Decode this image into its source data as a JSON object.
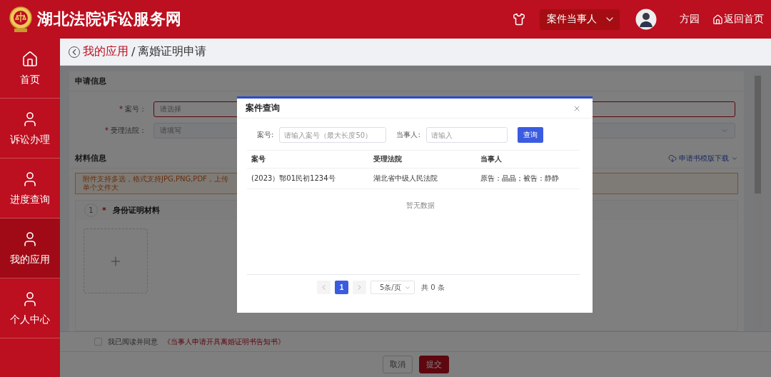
{
  "header": {
    "title": "湖北法院诉讼服务网",
    "role_select": {
      "value": "案件当事人"
    },
    "user_name": "方园",
    "home_link": "返回首页"
  },
  "sidebar": {
    "items": [
      {
        "label": "首页",
        "kind": "home",
        "selected": false
      },
      {
        "label": "诉讼办理",
        "kind": "person",
        "selected": false
      },
      {
        "label": "进度查询",
        "kind": "person",
        "selected": false
      },
      {
        "label": "我的应用",
        "kind": "person",
        "selected": true
      },
      {
        "label": "个人中心",
        "kind": "person",
        "selected": false
      }
    ]
  },
  "breadcrumb": {
    "parent": "我的应用",
    "separator": "/",
    "current": "离婚证明申请"
  },
  "form": {
    "section_title": "申请信息",
    "fields": [
      {
        "required_mark": "*",
        "label": "案号：",
        "placeholder": "请选择",
        "invalid": true,
        "kind": "input"
      },
      {
        "required_mark": "*",
        "label": "受理法院：",
        "placeholder": "请填写",
        "invalid": false,
        "kind": "select"
      }
    ]
  },
  "materials": {
    "section_title": "材料信息",
    "download_link": "申请书模版下载",
    "notice": "附件支持多选，格式支持JPG,PNG,PDF，上传单个文件大",
    "items": [
      {
        "index": "1",
        "required_mark": "*",
        "title": "身份证明材料"
      }
    ]
  },
  "agreement": {
    "checked": false,
    "label": "我已阅读并同意",
    "link": "《当事人申请开具离婚证明书告知书》"
  },
  "actions": {
    "cancel": "取消",
    "submit": "提交"
  },
  "dialog": {
    "title": "案件查询",
    "filters": [
      {
        "label": "案号:",
        "placeholder": "请输入案号（最大长度50）"
      },
      {
        "label": "当事人:",
        "placeholder": "请输入"
      }
    ],
    "search_button": "查询",
    "table": {
      "columns": [
        "案号",
        "受理法院",
        "当事人"
      ],
      "rows": [
        [
          "(2023）鄂01民初1234号",
          "湖北省中级人民法院",
          "原告：晶晶；被告：静静"
        ]
      ]
    },
    "empty_text": "暂无数据",
    "pagination": {
      "pages": [
        {
          "label": "1",
          "selected": true
        }
      ],
      "page_size": "5条/页",
      "total": "共 0 条"
    }
  }
}
